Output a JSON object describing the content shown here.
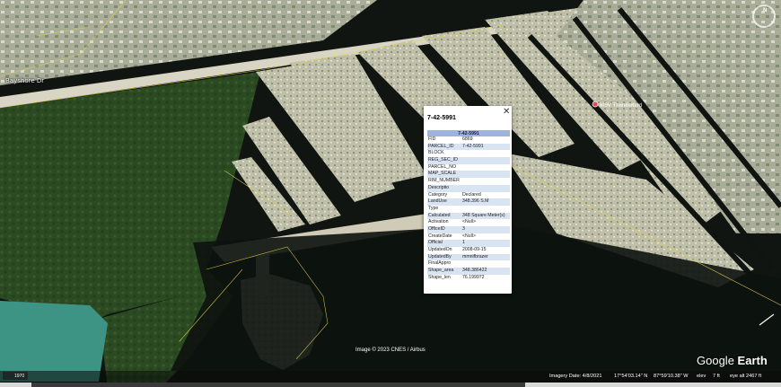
{
  "map": {
    "road_label": "Bayshore Dr",
    "poi_label": "MSV Thunderbird",
    "copyright": "Image © 2023 CNES / Airbus"
  },
  "popup": {
    "title": "7-42-5991",
    "table_header": "7-42-5991",
    "rows": [
      {
        "key": "FID",
        "value": "6869"
      },
      {
        "key": "PARCEL_ID",
        "value": "7-42-5991"
      },
      {
        "key": "BLOCK",
        "value": ""
      },
      {
        "key": "REG_SEC_ID",
        "value": ""
      },
      {
        "key": "PARCEL_NO",
        "value": ""
      },
      {
        "key": "MAP_SCALE",
        "value": ""
      },
      {
        "key": "RIM_NUMBER",
        "value": ""
      },
      {
        "key": "Descriptio",
        "value": ""
      },
      {
        "key": "Category",
        "value": "Declared"
      },
      {
        "key": "LandUse",
        "value": "348.396 S.M"
      },
      {
        "key": "Type",
        "value": ""
      },
      {
        "key": "Calculated",
        "value": "348 Square Meter(s)"
      },
      {
        "key": "Activation",
        "value": "<Null>"
      },
      {
        "key": "OfficeID",
        "value": "3"
      },
      {
        "key": "CreateDate",
        "value": "<Null>"
      },
      {
        "key": "Official",
        "value": "1"
      },
      {
        "key": "UpdatedOn",
        "value": "2008-09-15"
      },
      {
        "key": "UpdatedBy",
        "value": "mmnifbrazer"
      },
      {
        "key": "FinalAppro",
        "value": ""
      },
      {
        "key": "Shape_area",
        "value": "348.386422"
      },
      {
        "key": "Shape_len",
        "value": "76.199972"
      }
    ]
  },
  "brand": {
    "part1": "Google ",
    "part2": "Earth"
  },
  "status": {
    "imagery_date": "Imagery Date: 4/8/2021",
    "lat": "17°54'03.14\" N",
    "lon": "87°59'10.38\" W",
    "elev_label": "elev",
    "elev_value": "7 ft",
    "eye_alt": "eye alt  2467 ft",
    "scale": "1970"
  },
  "nav": {
    "north": "N"
  },
  "colors": {
    "water": "#0e1410",
    "mangrove": "#2d4a22",
    "sand": "#c8c7b2",
    "parcel_line": "#e8d34a",
    "lagoon": "#3b8f7f",
    "popup_header": "#9cb3dc",
    "popup_alt_row": "#d9e4f3"
  }
}
